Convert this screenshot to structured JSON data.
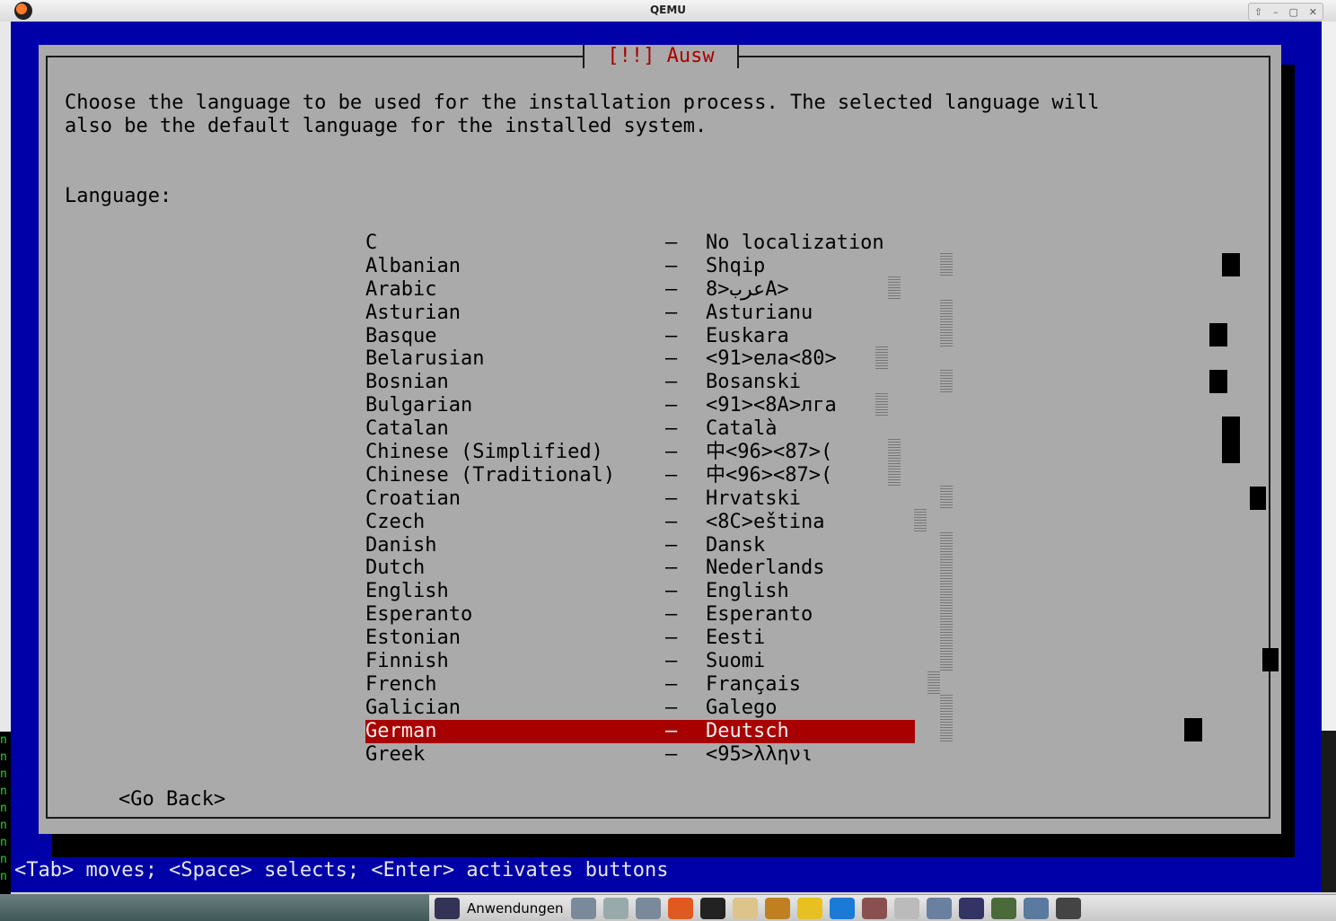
{
  "window": {
    "title": "QEMU"
  },
  "dialog": {
    "title": "[!!] Ausw",
    "description_line1": "Choose the language to be used for the installation process. The selected language will",
    "description_line2": "also be the default language for the installed system.",
    "language_label": "Language:",
    "go_back": "<Go Back>"
  },
  "languages": [
    {
      "name": "C",
      "native": "No localization"
    },
    {
      "name": "Albanian",
      "native": "Shqip"
    },
    {
      "name": "Arabic",
      "native": "عرب<8A>"
    },
    {
      "name": "Asturian",
      "native": "Asturianu"
    },
    {
      "name": "Basque",
      "native": "Euskara"
    },
    {
      "name": "Belarusian",
      "native": "<91>ела<80>"
    },
    {
      "name": "Bosnian",
      "native": "Bosanski"
    },
    {
      "name": "Bulgarian",
      "native": "<91><8A>лга"
    },
    {
      "name": "Catalan",
      "native": "Català"
    },
    {
      "name": "Chinese (Simplified)",
      "native": "中<96><87>("
    },
    {
      "name": "Chinese (Traditional)",
      "native": "中<96><87>("
    },
    {
      "name": "Croatian",
      "native": "Hrvatski"
    },
    {
      "name": "Czech",
      "native": "<8C>eština"
    },
    {
      "name": "Danish",
      "native": "Dansk"
    },
    {
      "name": "Dutch",
      "native": "Nederlands"
    },
    {
      "name": "English",
      "native": "English"
    },
    {
      "name": "Esperanto",
      "native": "Esperanto"
    },
    {
      "name": "Estonian",
      "native": "Eesti"
    },
    {
      "name": "Finnish",
      "native": "Suomi"
    },
    {
      "name": "French",
      "native": "Français"
    },
    {
      "name": "Galician",
      "native": "Galego"
    },
    {
      "name": "German",
      "native": "Deutsch",
      "selected": true
    },
    {
      "name": "Greek",
      "native": "<95>λληνι"
    }
  ],
  "separator": "–",
  "status_bar": "<Tab> moves; <Space> selects; <Enter> activates buttons",
  "taskbar": {
    "menu_label": "Anwendungen"
  },
  "colors": {
    "console_blue": "#0000a8",
    "dialog_gray": "#aaaaaa",
    "highlight_red": "#a80000"
  },
  "left_terminal_glyph": "n"
}
